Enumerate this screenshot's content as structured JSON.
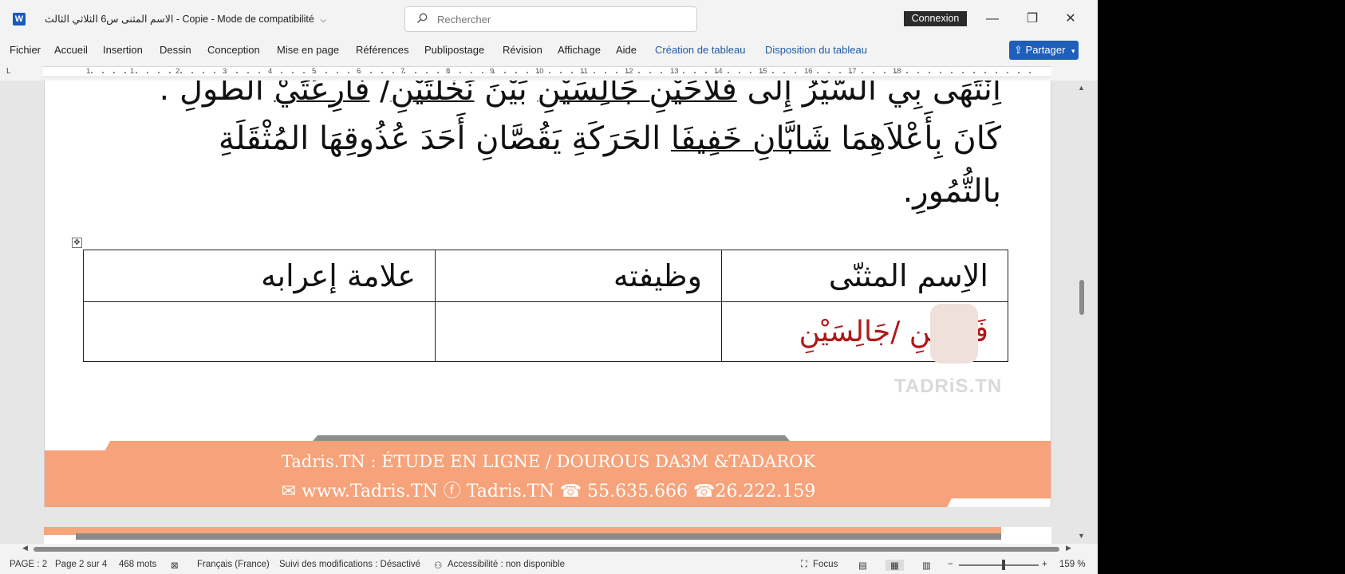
{
  "app": {
    "title": "الاسم المثنى س6 الثلاثي الثالث - Copie",
    "mode": "Mode de compatibilité",
    "logo_letter": "W"
  },
  "search": {
    "placeholder": "Rechercher"
  },
  "account": {
    "signin_label": "Connexion"
  },
  "window": {
    "minimize": "—",
    "restore": "❐",
    "close": "✕"
  },
  "ribbon": {
    "tabs": [
      "Fichier",
      "Accueil",
      "Insertion",
      "Dessin",
      "Conception",
      "Mise en page",
      "Références",
      "Publipostage",
      "Révision",
      "Affichage",
      "Aide",
      "Création de tableau",
      "Disposition du tableau"
    ],
    "share_label": "Partager"
  },
  "ruler": {
    "corner": "L",
    "numbers": [
      "1",
      "1",
      "2",
      "3",
      "4",
      "5",
      "6",
      "7",
      "8",
      "9",
      "10",
      "11",
      "12",
      "13",
      "14",
      "15",
      "16",
      "17",
      "18"
    ]
  },
  "document": {
    "line1_parts": {
      "a": "اِنْتَهَى بِي السَّيْرُ إِلَى ",
      "u1": "فَلاَّحَيْنِ جَالِسَيْنِ",
      "b": " بَيْنَ ",
      "u2": "نَخْلَتَيْنِ",
      "c": "/ ",
      "u3": "فَارِعَتَيْ",
      "d": " الطُّولِ ."
    },
    "line2_parts": {
      "a": "كَانَ بِأَعْلاَهِمَا ",
      "u1": "شَابَّانِ خَفِيفَا",
      "b": " الحَرَكَةِ يَقُصَّانِ أَحَدَ عُذُوقِهَا المُثْقَلَةِ"
    },
    "line3": "بالتُّمُورِ.",
    "table": {
      "headers": [
        "الاِسم المثنّى",
        "وظيفته",
        "علامة إعرابه"
      ],
      "answer": "فَلاَّحَيْنِ /جَالِسَيْنِ",
      "move_handle": "✥"
    },
    "watermark": "TADRiS.TN",
    "footer": {
      "line1": "Tadris.TN : ÉTUDE EN LIGNE / DOUROUS DA3M &TADAROK",
      "line2": "✉ www.Tadris.TN    ⓕ  Tadris.TN    ☎ 55.635.666 ☎26.222.159"
    }
  },
  "statusbar": {
    "page": "PAGE : 2",
    "page_of": "Page 2 sur 4",
    "words": "468 mots",
    "language": "Français (France)",
    "track_changes": "Suivi des modifications : Désactivé",
    "accessibility": "Accessibilité : non disponible",
    "focus": "Focus",
    "zoom_minus": "−",
    "zoom_plus": "+",
    "zoom": "159 %"
  }
}
